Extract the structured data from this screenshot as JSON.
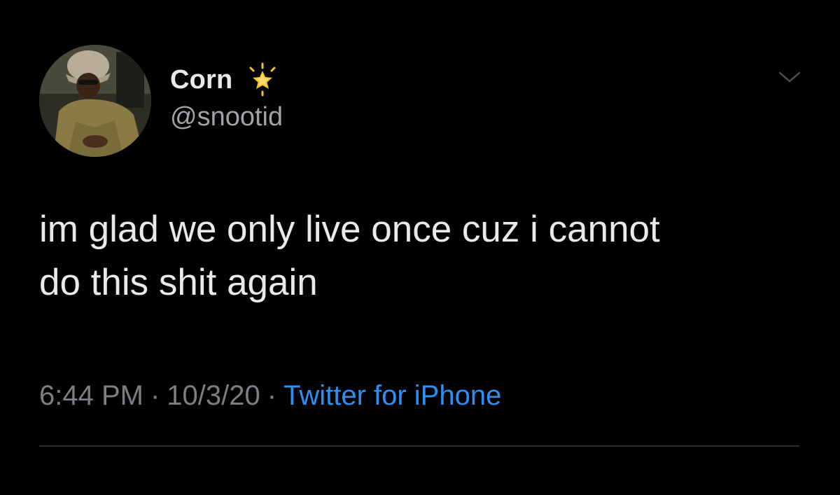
{
  "tweet": {
    "author": {
      "display_name": "Corn",
      "handle": "@snootid",
      "badge_icon": "glowing-star-icon",
      "avatar_icon": "profile-photo"
    },
    "menu_icon": "chevron-down-icon",
    "text_line1": "im glad we only live once cuz i cannot",
    "text_line2": "do this shit again",
    "time": "6:44 PM",
    "date": "10/3/20",
    "separator": "·",
    "source": "Twitter for iPhone"
  },
  "colors": {
    "background": "#000000",
    "text": "#e7e9ea",
    "secondary": "#7b7f83",
    "link": "#2f8ef0",
    "star": "#f6c22b"
  }
}
